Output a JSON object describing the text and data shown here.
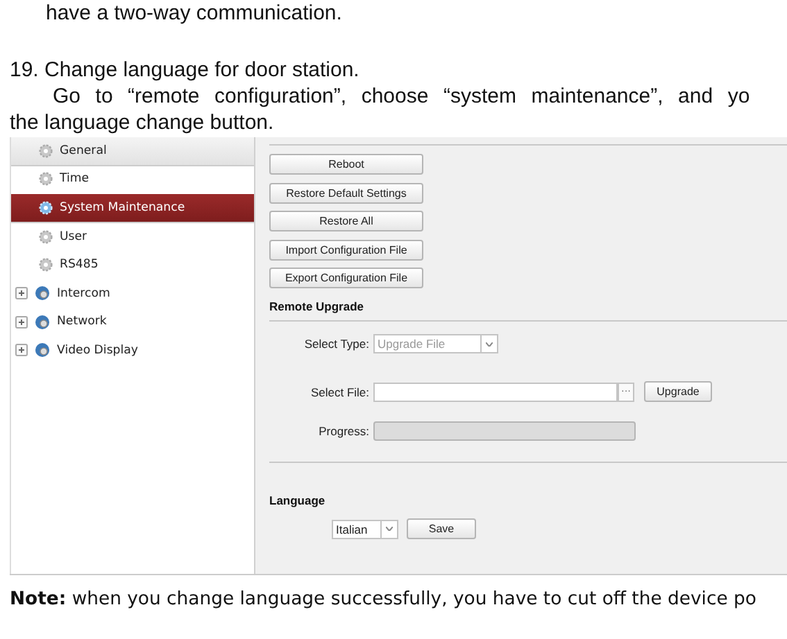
{
  "document": {
    "lines_top": [
      "have a two-way communication.",
      "19. Change language for door station."
    ],
    "paragraph_line": "Go to “remote configuration”, choose “system maintenance”, and yo",
    "paragraph_end": "the language change button.",
    "note": "**Note:** when you change language successfully, you have to cut off the device po"
  },
  "sidebar": {
    "items": [
      {
        "label": "General",
        "kind": "setting",
        "selected": false
      },
      {
        "label": "Time",
        "kind": "setting",
        "selected": false
      },
      {
        "label": "System Maintenance",
        "kind": "setting",
        "selected": true
      },
      {
        "label": "User",
        "kind": "setting",
        "selected": false
      },
      {
        "label": "RS485",
        "kind": "setting",
        "selected": false
      },
      {
        "label": "Intercom",
        "kind": "group",
        "expanded": false,
        "selected": false
      },
      {
        "label": "Network",
        "kind": "group",
        "expanded": false,
        "selected": false
      },
      {
        "label": "Video Display",
        "kind": "group",
        "expanded": false,
        "selected": false
      }
    ]
  },
  "maintenance_buttons": [
    "Reboot",
    "Restore Default Settings",
    "Restore All",
    "Import Configuration File",
    "Export Configuration File"
  ],
  "remote_upgrade": {
    "heading": "Remote Upgrade",
    "select_type_label": "Select Type:",
    "select_type_value": "Upgrade File",
    "select_type_disabled": true,
    "select_file_label": "Select File:",
    "browse_button": "···",
    "upgrade_button": "Upgrade",
    "progress_label": "Progress:"
  },
  "language": {
    "heading": "Language",
    "value": "Italian",
    "save_button": "Save"
  }
}
